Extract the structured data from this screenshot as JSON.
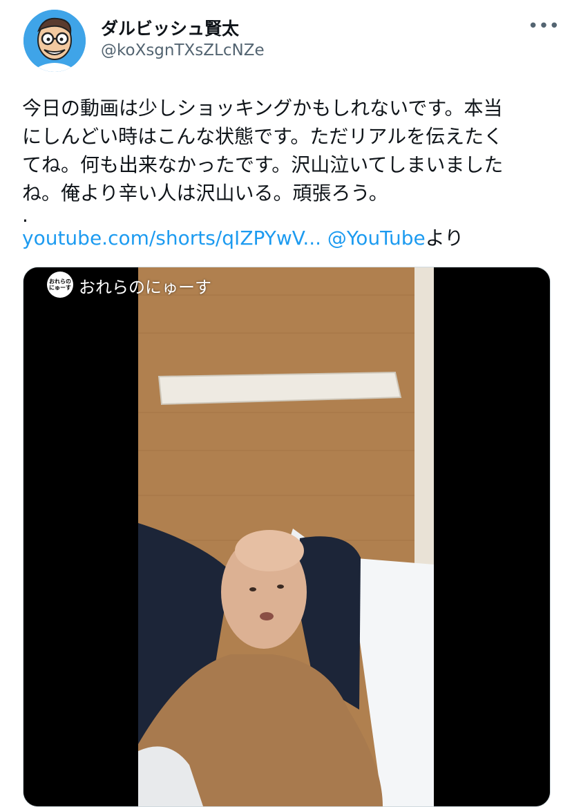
{
  "author": {
    "display_name": "ダルビッシュ賢太",
    "handle": "@koXsgnTXsZLcNZe",
    "avatar_icon": "cartoon-avatar-icon"
  },
  "more_icon": "more-options-icon",
  "more_label": "•••",
  "tweet": {
    "lines": [
      "今日の動画は少しショッキングかもしれないです。本当",
      "にしんどい時はこんな状態です。ただリアルを伝えたく",
      "てね。何も出来なかったです。沢山泣いてしまいました",
      "ね。俺より辛い人は沢山いる。頑張ろう。"
    ],
    "dot": ".",
    "link_url": "youtube.com/shorts/qIZPYwV...",
    "mention": "@YouTube",
    "suffix": "より"
  },
  "video": {
    "channel_logo_text": "おれらのにゅーす",
    "channel_name": "おれらのにゅーす"
  },
  "colors": {
    "link": "#1d9bf0",
    "secondary_text": "#536471",
    "avatar_bg": "#3fa4e8"
  }
}
